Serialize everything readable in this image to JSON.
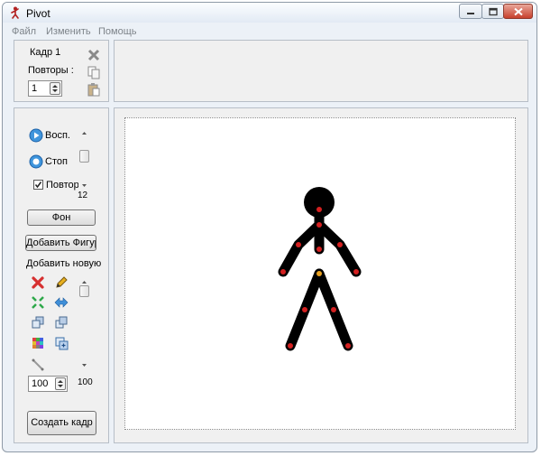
{
  "window": {
    "title": "Pivot"
  },
  "menu": {
    "file": "Файл",
    "edit": "Изменить",
    "help": "Помощь"
  },
  "frame_panel": {
    "frame_label": "Кадр 1",
    "repeats_label": "Повторы :",
    "repeats_value": "1"
  },
  "playback": {
    "play_label": "Восп.",
    "stop_label": "Стоп",
    "loop_label": "Повтор",
    "loop_checked": true,
    "speed_value": "12"
  },
  "figures": {
    "background_button": "Фон",
    "add_figure_button": "Добавить Фигуру",
    "add_new_label": "Добавить новую ф",
    "size_value": "100",
    "size_scroll_value": "100"
  },
  "create_frame_button": "Создать кадр",
  "colors": {
    "figure": "#000000",
    "joint": "#d42020",
    "origin_joint": "#e8a020",
    "canvas": "#ffffff"
  },
  "icons": [
    "close-icon",
    "copy-icon",
    "paste-icon",
    "play-icon",
    "stop-icon",
    "delete-icon",
    "edit-icon",
    "join-icon",
    "flip-icon",
    "front-icon",
    "back-icon",
    "color-icon",
    "duplicate-icon",
    "line-icon"
  ]
}
